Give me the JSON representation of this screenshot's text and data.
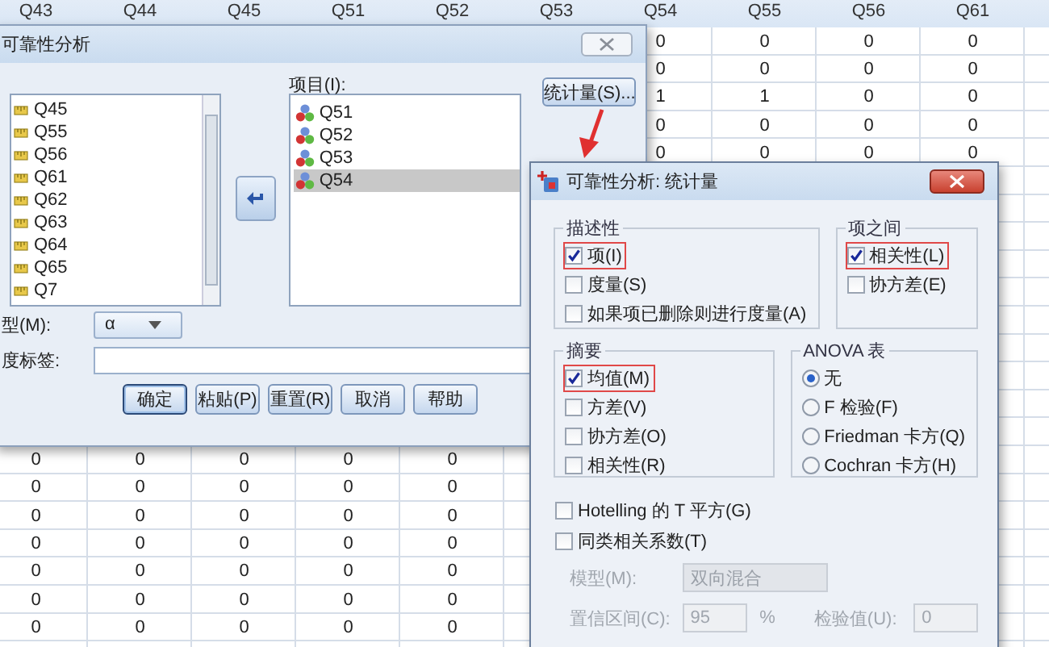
{
  "sheet": {
    "columns": [
      "Q43",
      "Q44",
      "Q45",
      "Q51",
      "Q52",
      "Q53",
      "Q54",
      "Q55",
      "Q56",
      "Q61"
    ],
    "upper_rows": [
      [
        "0",
        "0",
        "0",
        "0"
      ],
      [
        "0",
        "0",
        "0",
        "0"
      ],
      [
        "1",
        "1",
        "0",
        "0"
      ],
      [
        "0",
        "0",
        "0",
        "0"
      ],
      [
        "0",
        "0",
        "0",
        "0"
      ]
    ],
    "lower_rows": [
      [
        "0",
        "0",
        "0",
        "0",
        "0"
      ],
      [
        "0",
        "0",
        "0",
        "0",
        "0"
      ],
      [
        "0",
        "0",
        "0",
        "0",
        "0"
      ],
      [
        "0",
        "0",
        "0",
        "0",
        "0"
      ],
      [
        "0",
        "0",
        "0",
        "0",
        "0"
      ],
      [
        "0",
        "0",
        "0",
        "0",
        "0"
      ],
      [
        "0",
        "0",
        "0",
        "0",
        "0"
      ]
    ]
  },
  "reliability_dialog": {
    "title": "可靠性分析",
    "variables": [
      "Q45",
      "Q55",
      "Q56",
      "Q61",
      "Q62",
      "Q63",
      "Q64",
      "Q65",
      "Q7"
    ],
    "items_label": "项目(I):",
    "items": [
      {
        "name": "Q51",
        "selected": false
      },
      {
        "name": "Q52",
        "selected": false
      },
      {
        "name": "Q53",
        "selected": false
      },
      {
        "name": "Q54",
        "selected": true
      }
    ],
    "statistics_button": "统计量(S)...",
    "model_label": "型(M):",
    "model_value": "α",
    "scale_label_label": "度标签:",
    "buttons": [
      {
        "label": "确定",
        "default": true
      },
      {
        "label": "粘贴(P)",
        "default": false
      },
      {
        "label": "重置(R)",
        "default": false
      },
      {
        "label": "取消",
        "default": false
      },
      {
        "label": "帮助",
        "default": false
      }
    ]
  },
  "statistics_dialog": {
    "title": "可靠性分析: 统计量",
    "groups": [
      {
        "title": "描述性",
        "kind": "checkbox",
        "options": [
          {
            "label": "项(I)",
            "checked": true,
            "highlighted": true
          },
          {
            "label": "度量(S)",
            "checked": false,
            "highlighted": false
          },
          {
            "label": "如果项已删除则进行度量(A)",
            "checked": false,
            "highlighted": false
          }
        ]
      },
      {
        "title": "项之间",
        "kind": "checkbox",
        "options": [
          {
            "label": "相关性(L)",
            "checked": true,
            "highlighted": true
          },
          {
            "label": "协方差(E)",
            "checked": false,
            "highlighted": false
          }
        ]
      },
      {
        "title": "摘要",
        "kind": "checkbox",
        "options": [
          {
            "label": "均值(M)",
            "checked": true,
            "highlighted": true
          },
          {
            "label": "方差(V)",
            "checked": false,
            "highlighted": false
          },
          {
            "label": "协方差(O)",
            "checked": false,
            "highlighted": false
          },
          {
            "label": "相关性(R)",
            "checked": false,
            "highlighted": false
          }
        ]
      },
      {
        "title": "ANOVA 表",
        "kind": "radio",
        "options": [
          {
            "label": "无",
            "selected": true
          },
          {
            "label": "F 检验(F)",
            "selected": false
          },
          {
            "label": "Friedman 卡方(Q)",
            "selected": false
          },
          {
            "label": "Cochran 卡方(H)",
            "selected": false
          }
        ]
      }
    ],
    "extra_options": [
      {
        "label": "Hotelling 的 T 平方(G)",
        "checked": false
      },
      {
        "label": "同类相关系数(T)",
        "checked": false
      }
    ],
    "model": {
      "label": "模型(M):",
      "value": "双向混合",
      "disabled": true
    },
    "confidence": {
      "label": "置信区间(C):",
      "value": "95",
      "unit": "%",
      "disabled": true
    },
    "test_value": {
      "label": "检验值(U):",
      "value": "0",
      "disabled": true
    }
  }
}
